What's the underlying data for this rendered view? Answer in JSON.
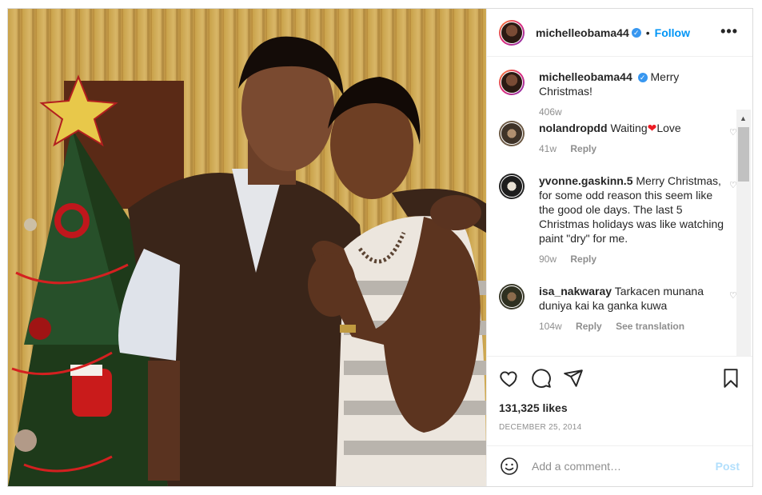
{
  "header": {
    "username": "michelleobama44",
    "verified": true,
    "separator": "•",
    "follow_label": "Follow",
    "more_label": "•••"
  },
  "photo": {
    "description_icon": "photo-image"
  },
  "caption": {
    "username": "michelleobama44",
    "text": "Merry Christmas!",
    "time": "406w"
  },
  "comments": [
    {
      "username": "nolandropdd",
      "text_a": "Waiting",
      "text_b": "Love",
      "emoji": "❤",
      "time": "41w",
      "reply": "Reply"
    },
    {
      "username": "yvonne.gaskinn.5",
      "text": "Merry Christmas, for some odd reason this seem like the good ole days. The last 5 Christmas holidays was like watching paint \"dry\" for me.",
      "time": "90w",
      "reply": "Reply"
    },
    {
      "username": "isa_nakwaray",
      "text": "Tarkacen munana duniya kai ka ganka kuwa",
      "time": "104w",
      "reply": "Reply",
      "translate": "See translation"
    }
  ],
  "likes": "131,325 likes",
  "date": "DECEMBER 25, 2014",
  "add_comment": {
    "placeholder": "Add a comment…",
    "post_label": "Post"
  },
  "icons": {
    "like": "heart-icon",
    "comment": "comment-icon",
    "share": "share-icon",
    "save": "bookmark-icon",
    "emoji": "emoji-icon"
  },
  "colors": {
    "link": "#0095f6",
    "verified": "#3897f0",
    "heart": "#ed1c24"
  }
}
